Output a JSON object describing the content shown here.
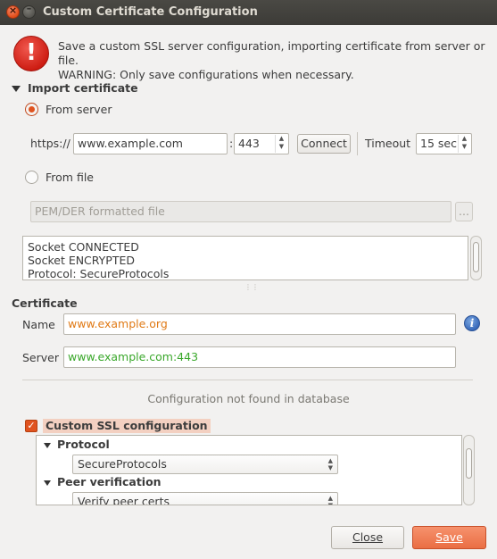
{
  "window": {
    "title": "Custom Certificate Configuration",
    "close_glyph": "×",
    "minimize_glyph": "–"
  },
  "warning": {
    "icon": "exclamation-icon",
    "glyph": "!",
    "line1": "Save a custom SSL server configuration, importing certificate from server or file.",
    "line2": "WARNING: Only save configurations when necessary."
  },
  "import": {
    "title": "Import certificate",
    "from_server_label": "From server",
    "from_server_selected": true,
    "scheme_label": "https://",
    "host_value": "www.example.com",
    "port_separator": ":",
    "port_value": "443",
    "connect_label": "Connect",
    "timeout_label": "Timeout",
    "timeout_value": "15 sec",
    "from_file_label": "From file",
    "file_placeholder": "PEM/DER formatted file",
    "browse_label": "...",
    "log_lines": [
      "Socket CONNECTED",
      "Socket ENCRYPTED",
      "Protocol: SecureProtocols"
    ]
  },
  "certificate": {
    "title": "Certificate",
    "name_label": "Name",
    "name_value": "www.example.org",
    "server_label": "Server",
    "server_value": "www.example.com:443",
    "info_glyph": "i"
  },
  "status": {
    "text": "Configuration not found in database"
  },
  "ssl": {
    "checkbox_checked": true,
    "checkmark": "✓",
    "label": "Custom SSL configuration",
    "protocol_title": "Protocol",
    "protocol_value": "SecureProtocols",
    "peer_title": "Peer verification",
    "peer_value": "Verify peer certs"
  },
  "buttons": {
    "close_label": "Close",
    "save_label": "Save"
  },
  "colors": {
    "accent": "#e0531f",
    "name_text": "#e07a16",
    "server_text": "#3aa82b",
    "save_button": "#ea6e44"
  }
}
